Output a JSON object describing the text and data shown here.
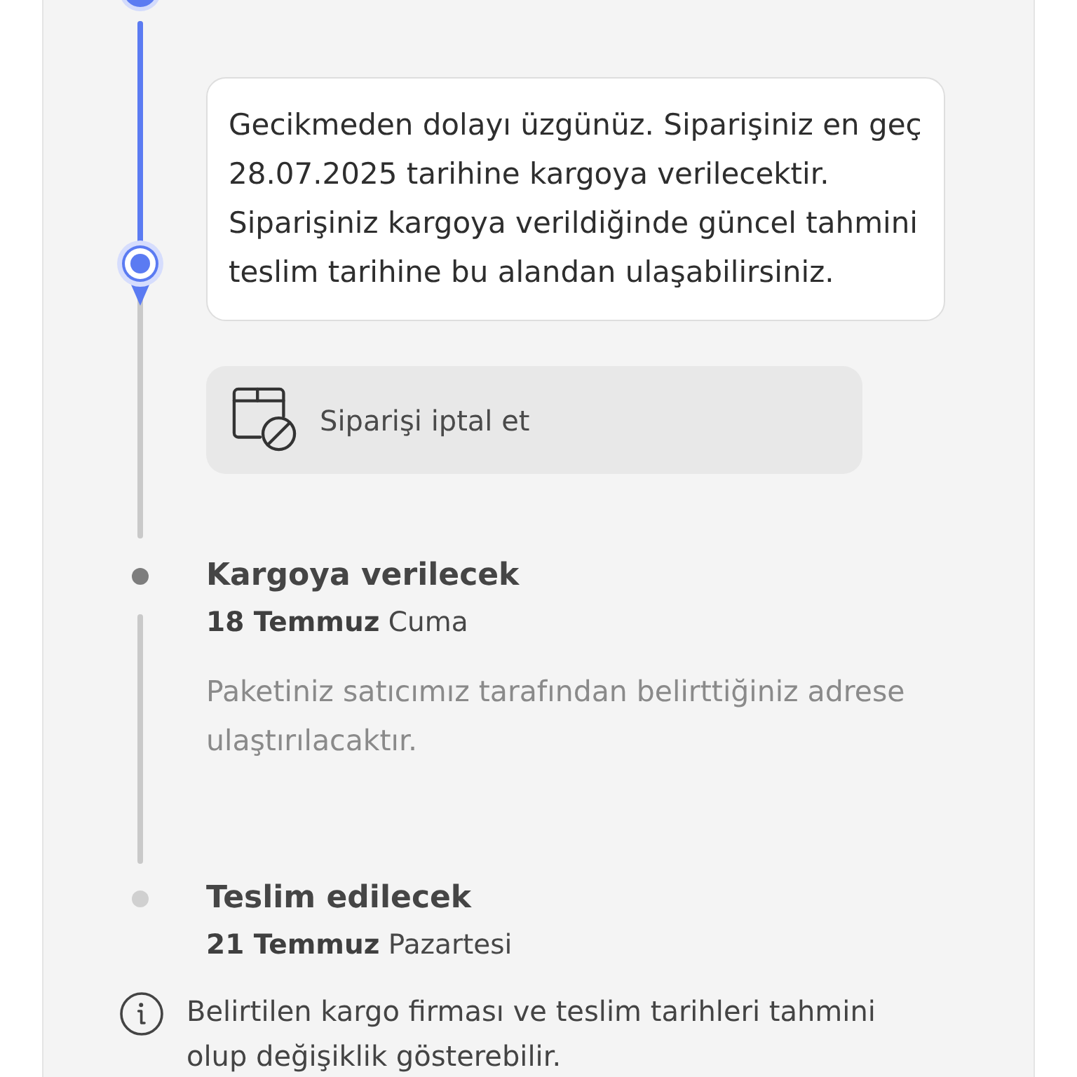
{
  "timeline": {
    "steps": [
      {
        "completed": true,
        "next": false,
        "progress": {
          "level": 0.47
        },
        "message": "Gecikmeden dolayı üzgünüz. Siparişiniz en geç 28.07.2025 tarihine kargoya verilecektir. Siparişiniz kargoya verildiğinde güncel tahmini teslim tarihine bu alandan ulaşabilirsiniz.",
        "action": {
          "label": "Siparişi iptal et"
        }
      },
      {
        "completed": false,
        "next": true,
        "title": "Kargoya verilecek",
        "date": "**18 Temmuz** Cuma",
        "description": "Paketiniz satıcımız tarafından belirttiğiniz adrese ulaştırılacaktır."
      },
      {
        "completed": false,
        "next": false,
        "title": "Teslim edilecek",
        "date": "**21 Temmuz** Pazartesi"
      }
    ]
  },
  "note": {
    "text": "Belirtilen kargo firması ve teslim tarihleri tahmini olup değişiklik gösterebilir."
  }
}
